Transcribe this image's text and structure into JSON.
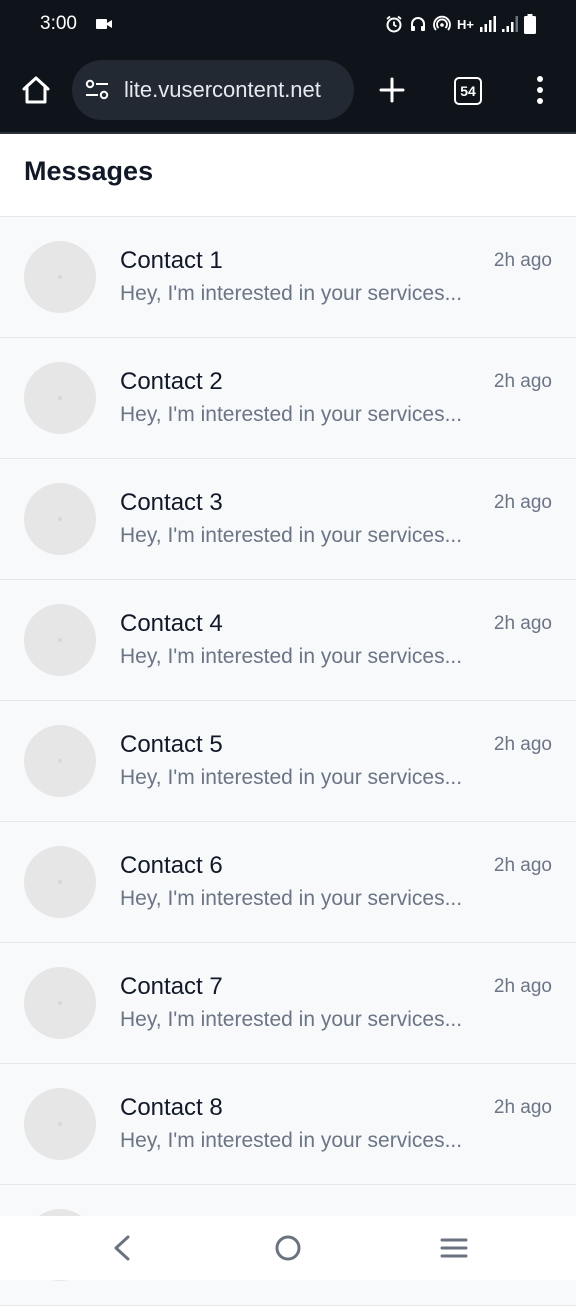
{
  "status_bar": {
    "time": "3:00",
    "network": "H+",
    "icons": [
      "video-camera-icon",
      "alarm-icon",
      "headphones-icon",
      "hotspot-icon",
      "signal-icon",
      "signal-icon",
      "battery-icon"
    ]
  },
  "browser": {
    "url": "lite.vusercontent.net",
    "tab_count": "54"
  },
  "page": {
    "title": "Messages"
  },
  "messages": [
    {
      "name": "Contact 1",
      "preview": "Hey, I'm interested in your services...",
      "time": "2h ago"
    },
    {
      "name": "Contact 2",
      "preview": "Hey, I'm interested in your services...",
      "time": "2h ago"
    },
    {
      "name": "Contact 3",
      "preview": "Hey, I'm interested in your services...",
      "time": "2h ago"
    },
    {
      "name": "Contact 4",
      "preview": "Hey, I'm interested in your services...",
      "time": "2h ago"
    },
    {
      "name": "Contact 5",
      "preview": "Hey, I'm interested in your services...",
      "time": "2h ago"
    },
    {
      "name": "Contact 6",
      "preview": "Hey, I'm interested in your services...",
      "time": "2h ago"
    },
    {
      "name": "Contact 7",
      "preview": "Hey, I'm interested in your services...",
      "time": "2h ago"
    },
    {
      "name": "Contact 8",
      "preview": "Hey, I'm interested in your services...",
      "time": "2h ago"
    },
    {
      "name": "",
      "preview": "",
      "time": ""
    }
  ],
  "colors": {
    "browser_chrome": "#0f141b",
    "url_pill": "#232933",
    "list_background": "#f8f9fb",
    "avatar": "#e6e6e7",
    "secondary_text": "#6b7585"
  }
}
